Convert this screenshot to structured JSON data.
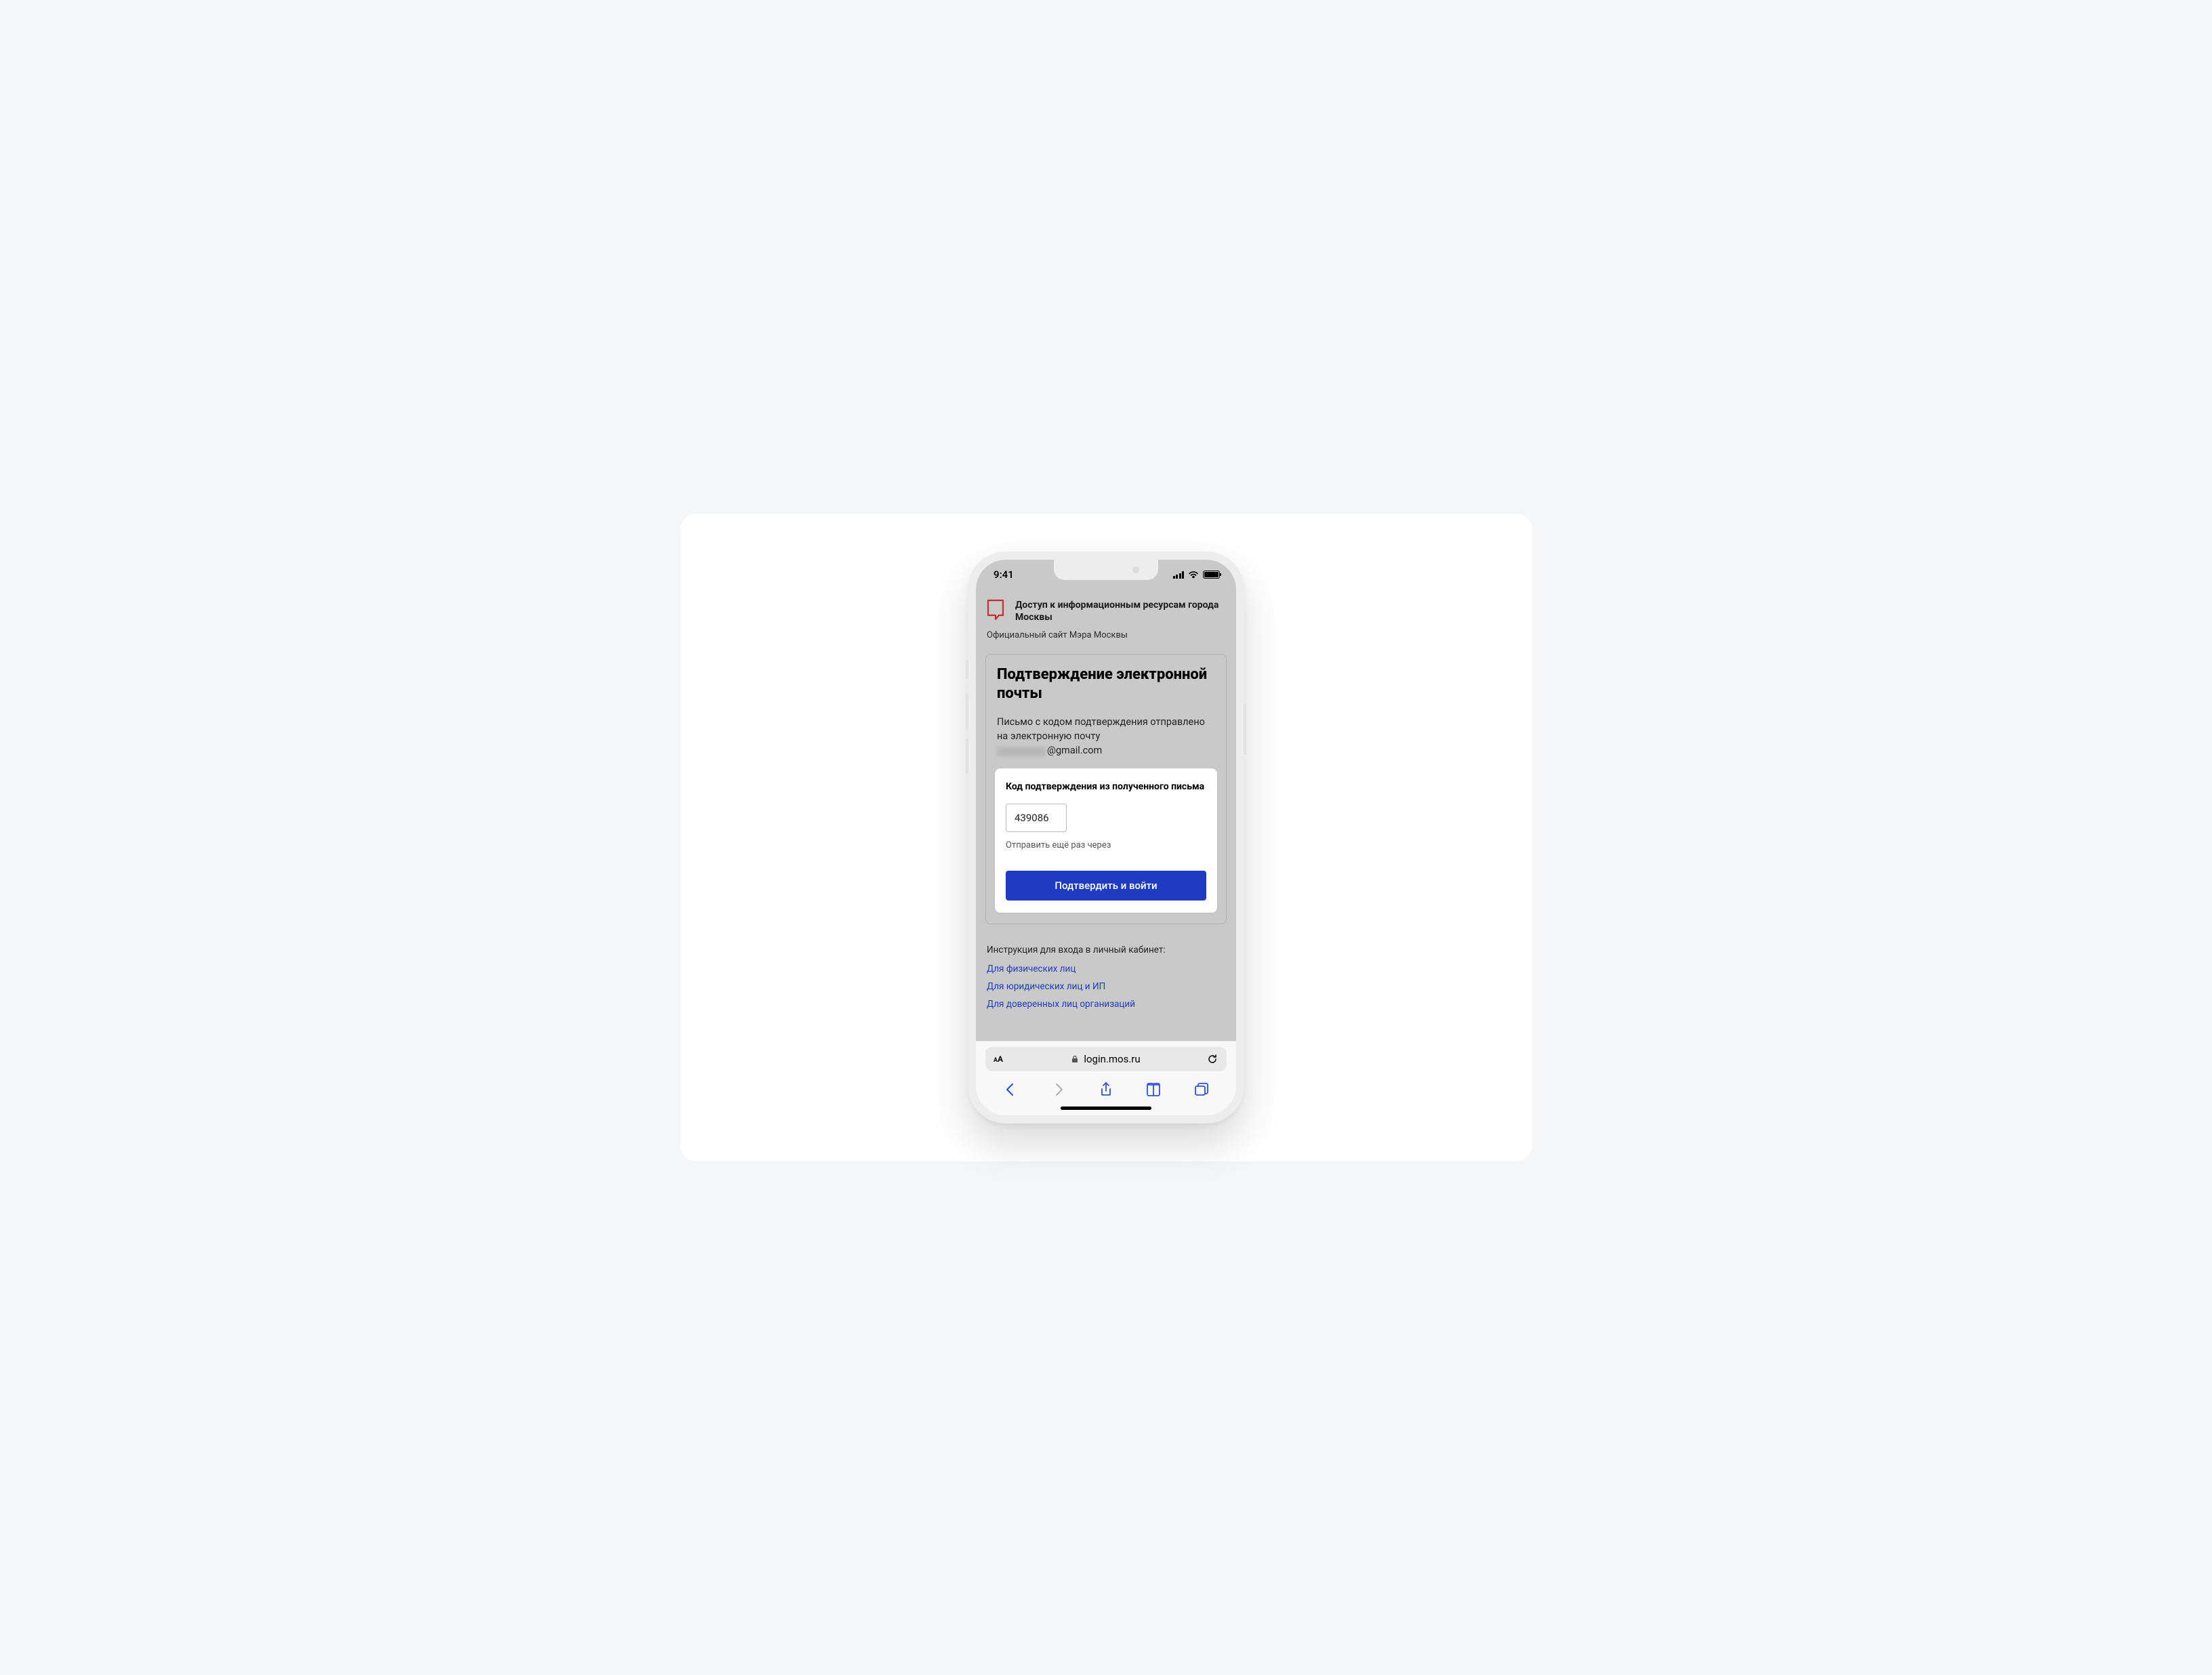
{
  "status": {
    "time": "9:41"
  },
  "header": {
    "title": "Доступ к информационным ресурсам города Москвы",
    "subtitle": "Официальный сайт Мэра Москвы"
  },
  "panel": {
    "heading": "Подтверждение электронной почты",
    "info_prefix": "Письмо с кодом подтверждения отправлено на электронную почту",
    "email_suffix": "@gmail.com"
  },
  "form": {
    "label": "Код подтверждения из полученного письма",
    "code_value": "439086",
    "resend_text": "Отправить ещё раз через",
    "submit_label": "Подтвердить и войти"
  },
  "instructions": {
    "title": "Инструкция для входа в личный кабинет:",
    "links": [
      "Для физических лиц",
      "Для юридических лиц и ИП",
      "Для доверенных лиц организаций"
    ]
  },
  "browser": {
    "url": "login.mos.ru"
  }
}
